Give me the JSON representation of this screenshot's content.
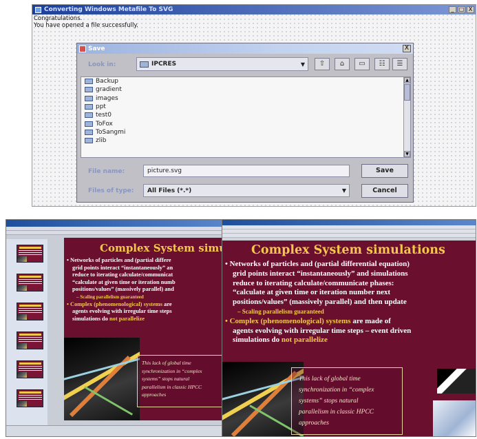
{
  "top_window": {
    "title": "Converting Windows Metafile To SVG",
    "messages": [
      "Congratulations.",
      "You have opened a file successfully."
    ],
    "controls": [
      "_",
      "□",
      "X"
    ]
  },
  "save_dialog": {
    "title": "Save",
    "close": "X",
    "look_in_label": "Look in:",
    "look_in_value": "IPCRES",
    "files": [
      "Backup",
      "gradient",
      "images",
      "ppt",
      "test0",
      "ToFox",
      "ToSangmi",
      "zlib"
    ],
    "file_name_label": "File name:",
    "file_name_value": "picture.svg",
    "files_of_type_label": "Files of type:",
    "files_of_type_value": "All Files (*.*)",
    "save_button": "Save",
    "cancel_button": "Cancel",
    "toolbar_icons": [
      "up-folder-icon",
      "home-icon",
      "new-folder-icon",
      "list-view-icon",
      "details-view-icon"
    ]
  },
  "slide": {
    "title": "Complex System simulations",
    "bullet1_lines": [
      "• Networks of particles and (partial differential equation)",
      "grid points interact “instantaneously” and simulations",
      "reduce to iterating calculate/communicate phases:",
      "“calculate at given time or iteration number next",
      "positions/values” (massively parallel) and then update"
    ],
    "sub_bullet": "– Scaling parallelism guaranteed",
    "bullet2_line1_yellow": "• Complex (phenomenological) systems",
    "bullet2_line1_white": " are made of",
    "bullet2_line2": "agents evolving with irregular time steps – event driven",
    "bullet2_line3_white": "simulations do ",
    "bullet2_line3_yellow": "not parallelize",
    "callout_lines": [
      "This lack of global time",
      "synchronization in “complex",
      "systems” stops natural",
      "parallelism in classic HPCC",
      "approaches"
    ]
  },
  "ppt_left": {
    "title_lines": [
      "Complex System simula"
    ],
    "lines": [
      "• Networks of particles and (partial differe",
      "grid points interact “instantaneously” an",
      "reduce to iterating calculate/communicat",
      "“calculate at given time or iteration numb",
      "positions/values” (massively parallel) and"
    ],
    "sub_bullet": "– Scaling parallelism guaranteed",
    "b2_yellow": "• Complex (phenomenological) systems",
    "b2_white": " are",
    "b2_line2": "agents evolving with irregular time steps",
    "b2_line3_white": "simulations do ",
    "b2_line3_yellow": "not parallelize",
    "callout_lines": [
      "This lack of global time",
      "synchronization in “complex",
      "systems” stops natural",
      "parallelism in classic HPCC",
      "approaches"
    ],
    "thumb_count": 6
  },
  "colors": {
    "slide_bg": "#6a0f2e",
    "slide_title": "#f5c84d",
    "dialog_bg": "#c0c0c6",
    "title_bar": "#1c3f9a"
  }
}
